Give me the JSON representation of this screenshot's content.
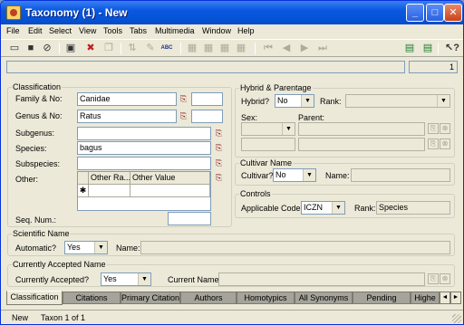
{
  "window": {
    "title": "Taxonomy (1) - New"
  },
  "menu": [
    "File",
    "Edit",
    "Select",
    "View",
    "Tools",
    "Tabs",
    "Multimedia",
    "Window",
    "Help"
  ],
  "toolbar": {
    "icons": [
      "new-record-icon",
      "save-icon",
      "cancel-icon",
      "form-icon",
      "delete-icon",
      "copy-icon",
      "sort-icon",
      "edit-icon",
      "spellcheck-icon",
      "grid-icon",
      "first-icon",
      "prev-icon",
      "next-icon",
      "last-icon",
      "report-icon",
      "whats-this-icon"
    ],
    "spellcheck_label": "ABC"
  },
  "record_count": "1",
  "classification": {
    "legend": "Classification",
    "family_label": "Family & No:",
    "family_value": "Canidae",
    "genus_label": "Genus & No:",
    "genus_value": "Ratus",
    "subgenus_label": "Subgenus:",
    "subgenus_value": "",
    "species_label": "Species:",
    "species_value": "bagus",
    "subspecies_label": "Subspecies:",
    "subspecies_value": "",
    "other_label": "Other:",
    "other_cols": [
      "Other Ra...",
      "Other Value"
    ],
    "new_row_marker": "✱",
    "seqnum_label": "Seq. Num.:",
    "seqnum_value": ""
  },
  "hybrid": {
    "legend": "Hybrid & Parentage",
    "hybrid_label": "Hybrid?",
    "hybrid_value": "No",
    "rank_label": "Rank:",
    "rank_value": "",
    "sex_label": "Sex:",
    "parent_label": "Parent:"
  },
  "cultivar": {
    "legend": "Cultivar Name",
    "cultivar_label": "Cultivar?",
    "cultivar_value": "No",
    "name_label": "Name:",
    "name_value": ""
  },
  "controls": {
    "legend": "Controls",
    "code_label": "Applicable Code:",
    "code_value": "ICZN",
    "rank_label": "Rank:",
    "rank_value": "Species"
  },
  "scientific": {
    "legend": "Scientific Name",
    "auto_label": "Automatic?",
    "auto_value": "Yes",
    "name_label": "Name:",
    "name_value": ""
  },
  "accepted": {
    "legend": "Currently Accepted Name",
    "accepted_label": "Currently Accepted?",
    "accepted_value": "Yes",
    "current_label": "Current Name:",
    "current_value": ""
  },
  "tabs": [
    "Classification",
    "Citations",
    "Primary Citation",
    "Authors",
    "Homotypics",
    "All Synonyms",
    "Pending",
    "Highe"
  ],
  "tab_nav": [
    "◄",
    "►"
  ],
  "status": {
    "mode": "New",
    "position": "Taxon 1 of 1"
  }
}
